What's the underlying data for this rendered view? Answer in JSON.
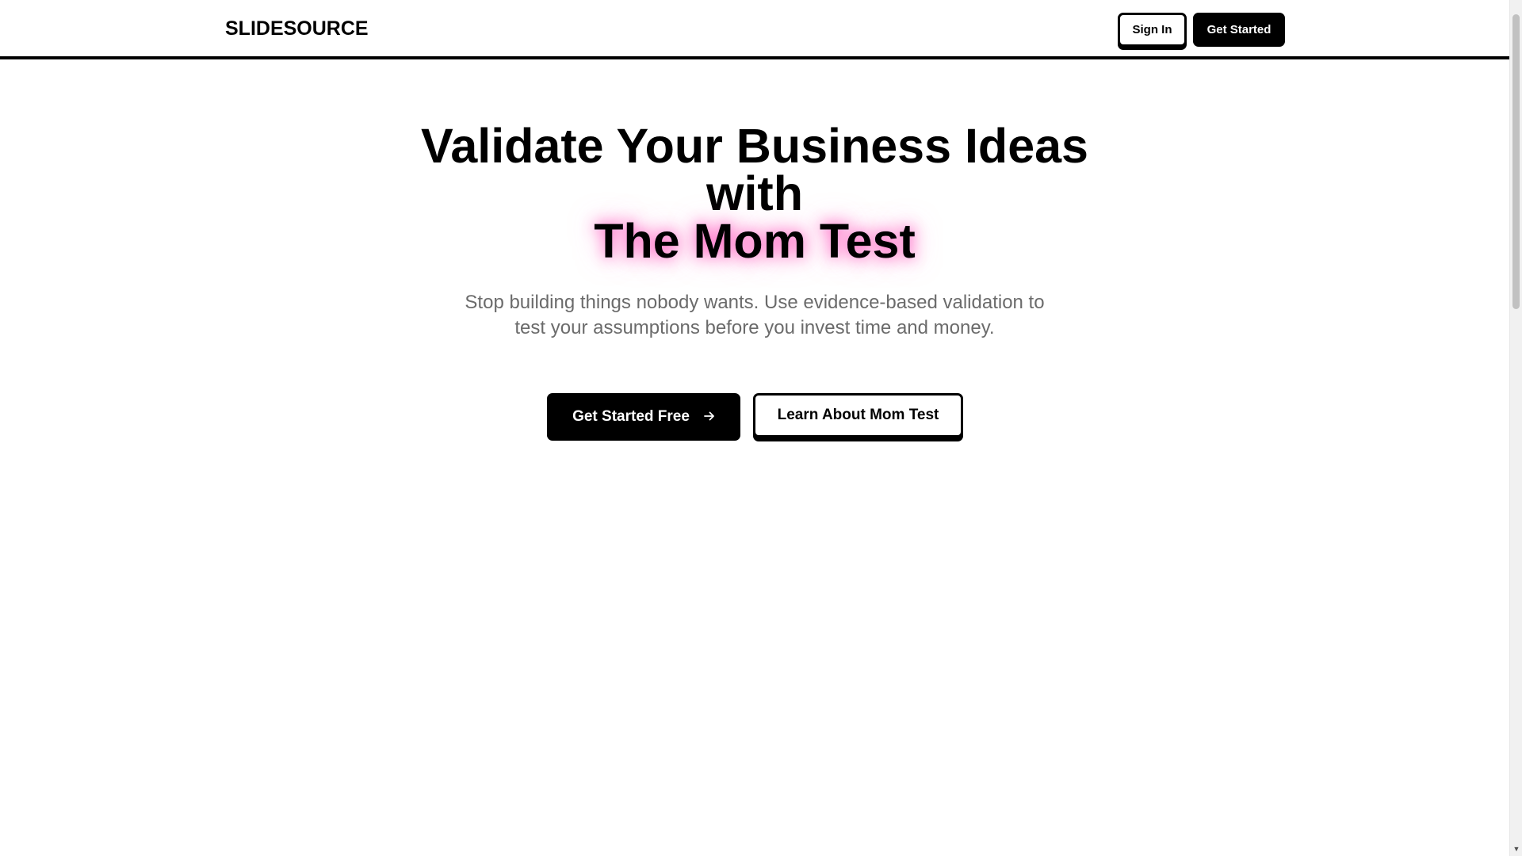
{
  "header": {
    "logo": "SLIDESOURCE",
    "sign_in_label": "Sign In",
    "get_started_label": "Get Started"
  },
  "hero": {
    "title_line1": "Validate Your Business Ideas",
    "title_line2": "with",
    "title_accent": "The Mom Test",
    "subtitle_line1": "Stop building things nobody wants. Use evidence-based validation to",
    "subtitle_line2": "test your assumptions before you invest time and money.",
    "primary_cta": "Get Started Free",
    "primary_cta_icon": "arrow-right-icon",
    "secondary_cta": "Learn About Mom Test"
  },
  "colors": {
    "primary": "#000000",
    "background": "#ffffff",
    "accent_glow": "#ff4fb4",
    "muted_text": "#6b6b6b"
  }
}
